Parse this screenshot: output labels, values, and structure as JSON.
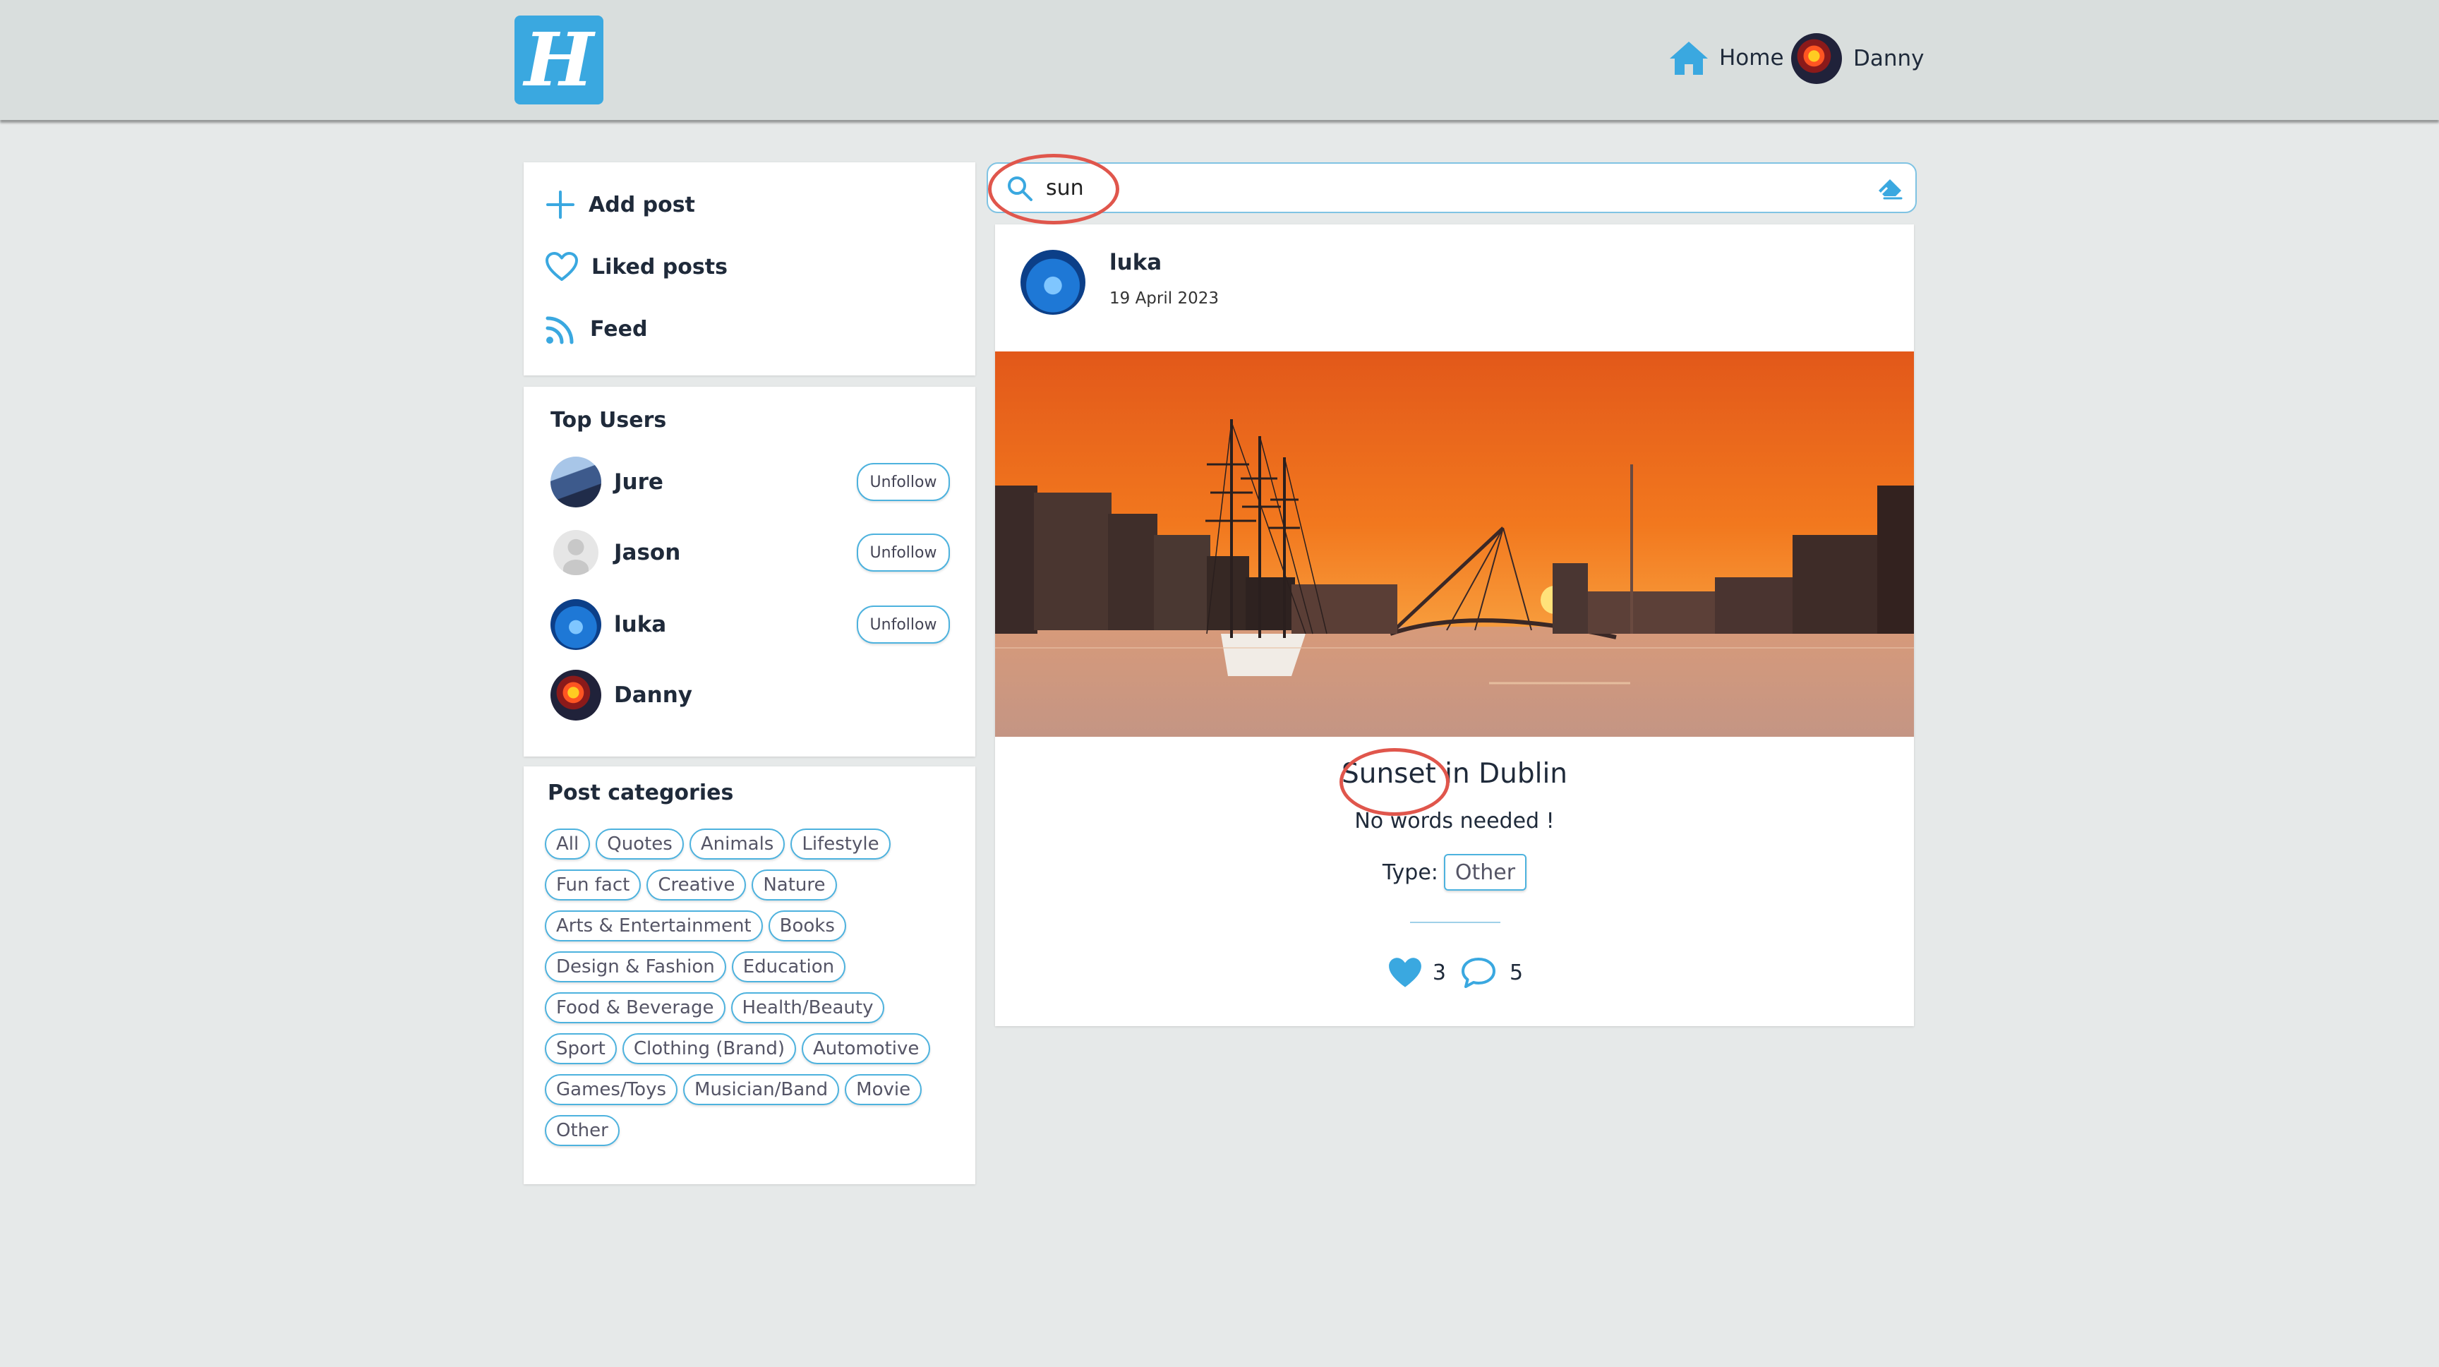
{
  "header": {
    "logo_letter": "H",
    "home_label": "Home",
    "user_name": "Danny"
  },
  "sidebar": {
    "menu": [
      {
        "label": "Add post",
        "icon": "plus-icon"
      },
      {
        "label": "Liked posts",
        "icon": "heart-outline-icon"
      },
      {
        "label": "Feed",
        "icon": "rss-icon"
      }
    ],
    "top_users": {
      "title": "Top Users",
      "users": [
        {
          "name": "Jure",
          "button": "Unfollow"
        },
        {
          "name": "Jason",
          "button": "Unfollow"
        },
        {
          "name": "luka",
          "button": "Unfollow"
        },
        {
          "name": "Danny"
        }
      ]
    },
    "categories": {
      "title": "Post categories",
      "items": [
        "All",
        "Quotes",
        "Animals",
        "Lifestyle",
        "Fun fact",
        "Creative",
        "Nature",
        "Arts & Entertainment",
        "Books",
        "Design & Fashion",
        "Education",
        "Food & Beverage",
        "Health/Beauty",
        "Sport",
        "Clothing (Brand)",
        "Automotive",
        "Games/Toys",
        "Musician/Band",
        "Movie",
        "Other"
      ]
    }
  },
  "search": {
    "value": "sun"
  },
  "post": {
    "author": "luka",
    "date": "19 April 2023",
    "title_highlight": "Sunset",
    "title_rest": " in Dublin",
    "description": "No words needed !",
    "type_label": "Type:",
    "type_value": "Other",
    "likes": "3",
    "comments": "5"
  },
  "colors": {
    "accent": "#3aa8e0",
    "highlight_ring": "#e0564c",
    "header_bg": "#d9dedd",
    "page_bg": "#e6e9e9"
  }
}
